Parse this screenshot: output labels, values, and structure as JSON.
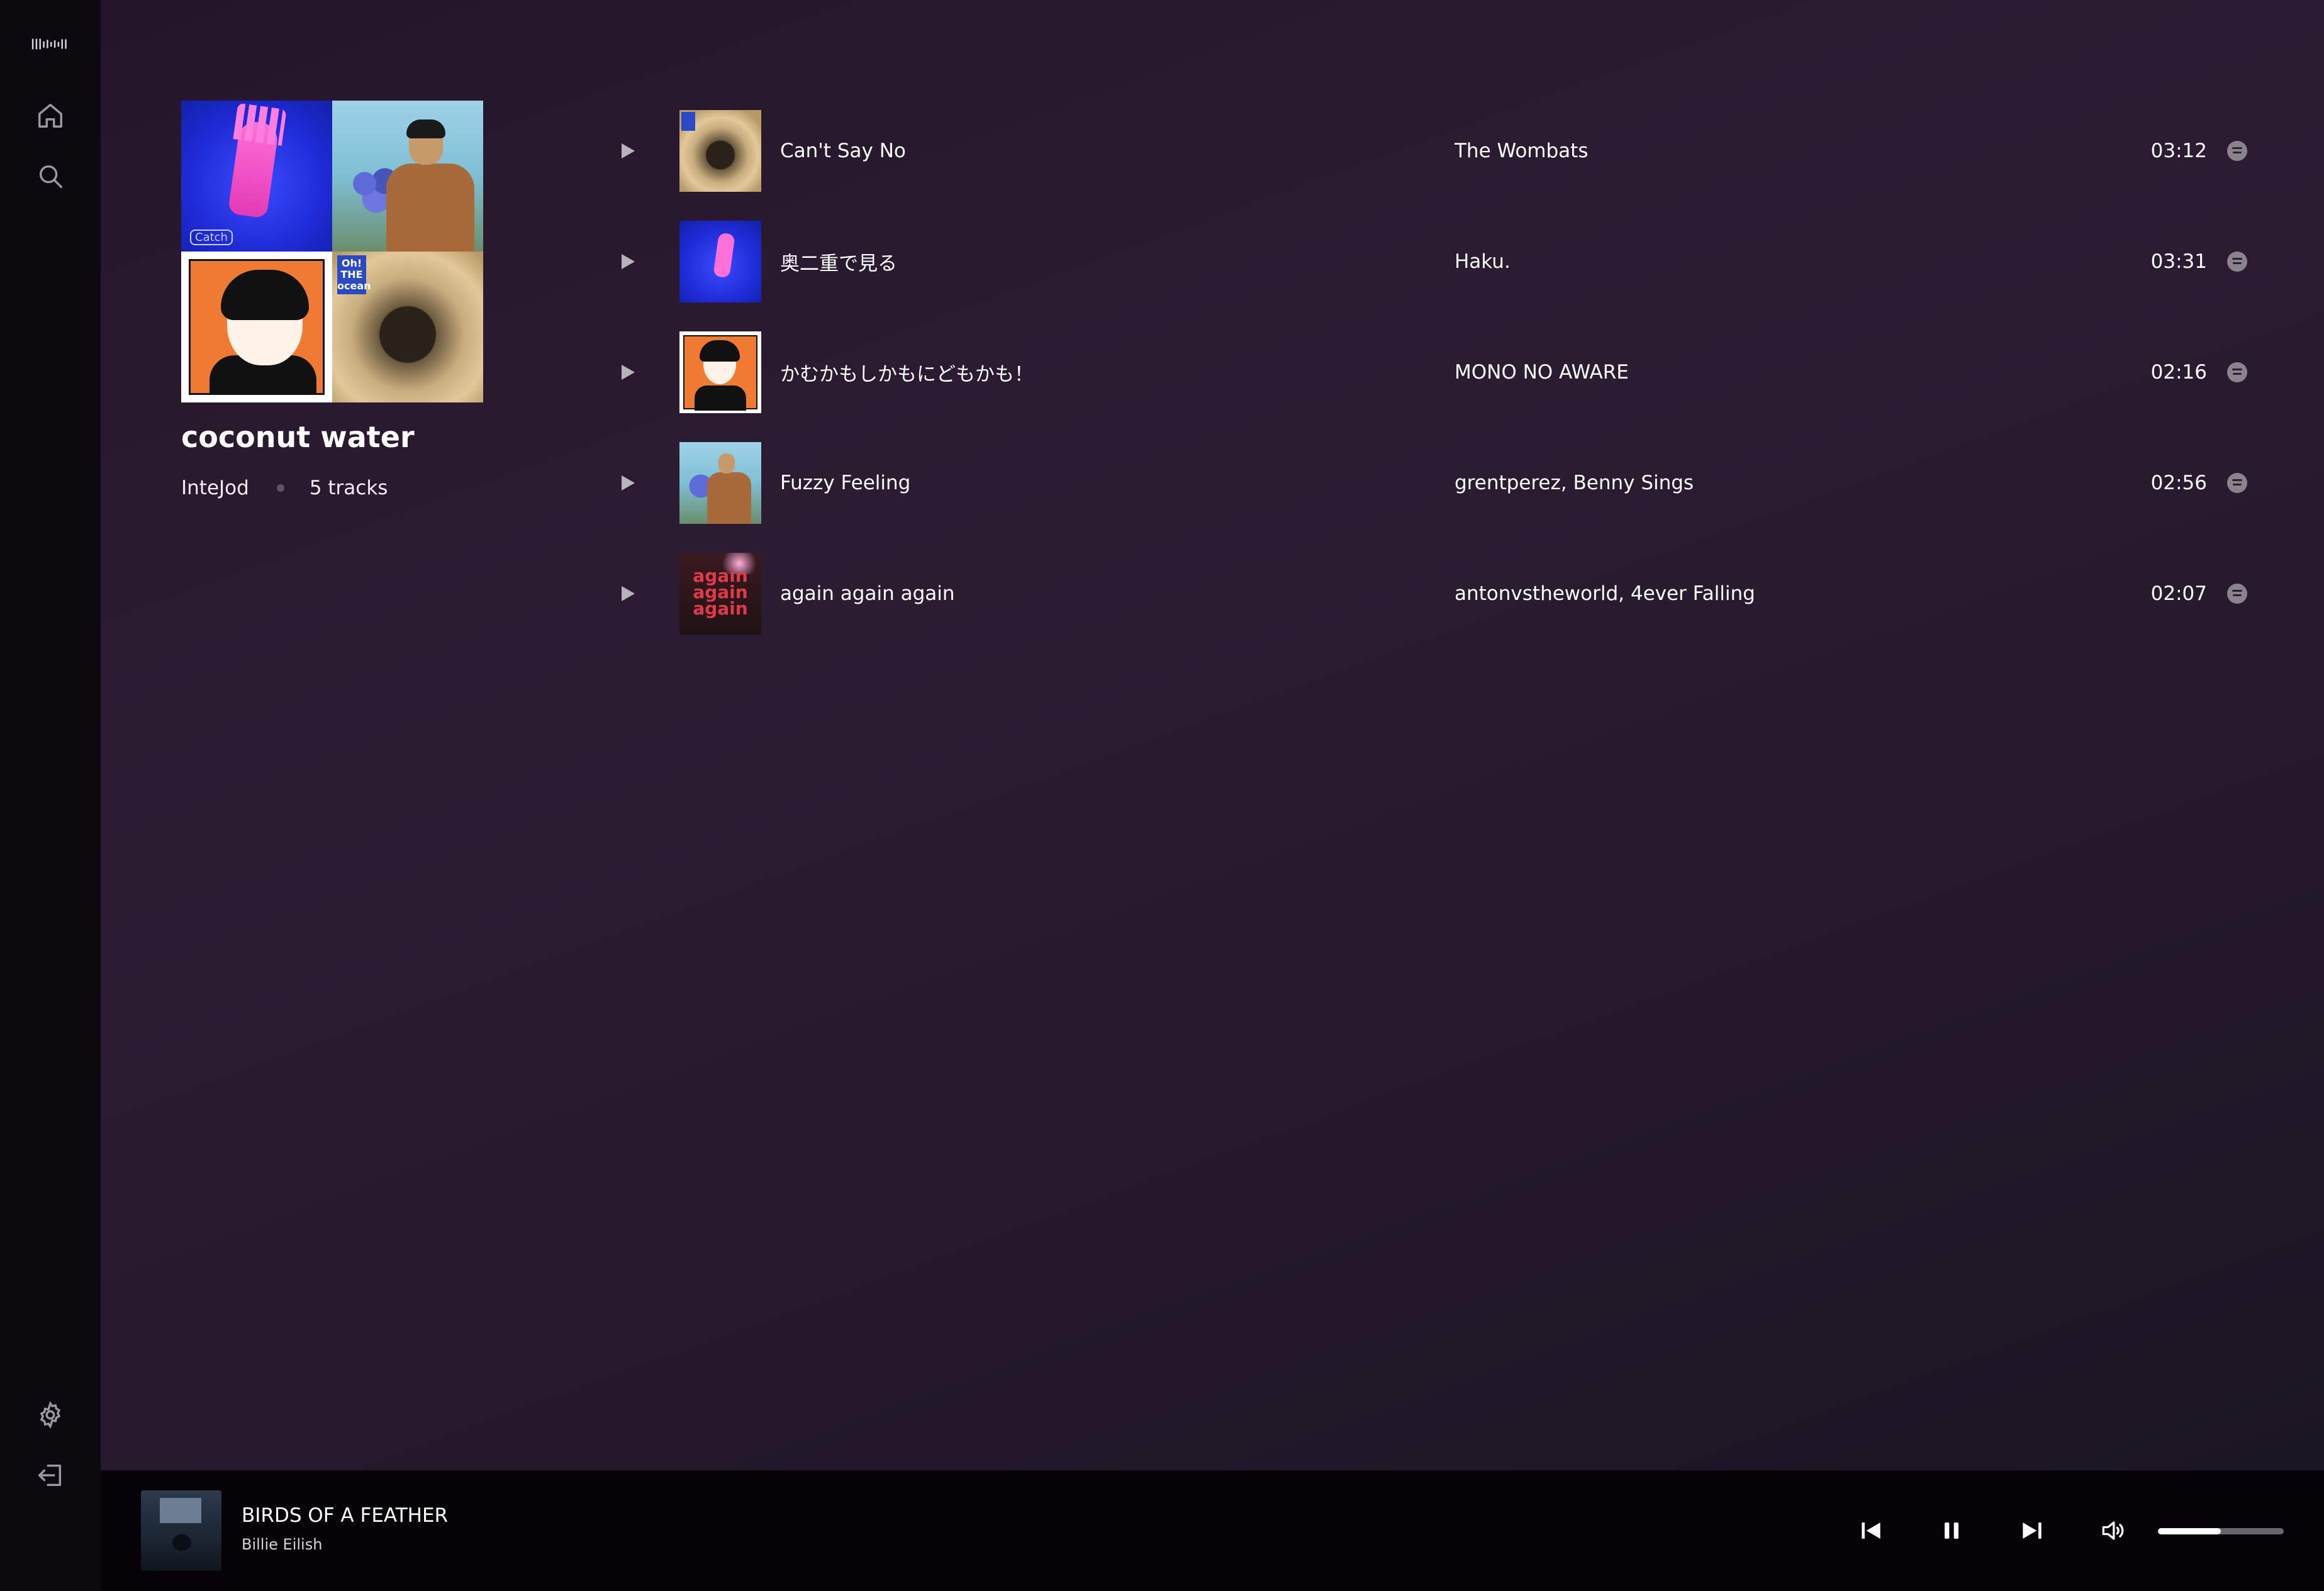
{
  "sidebar": {
    "icons": [
      "logo-bars-icon",
      "home-icon",
      "search-icon",
      "settings-icon",
      "logout-icon"
    ]
  },
  "playlist": {
    "title": "coconut water",
    "owner": "InteJod",
    "track_count": "5 tracks"
  },
  "tracks": [
    {
      "title": "Can't Say No",
      "artist": "The Wombats",
      "duration": "03:12"
    },
    {
      "title": "奥二重で見る",
      "artist": "Haku.",
      "duration": "03:31"
    },
    {
      "title": "かむかもしかもにどもかも！",
      "artist": "MONO NO AWARE",
      "duration": "02:16"
    },
    {
      "title": "Fuzzy Feeling",
      "artist": "grentperez, Benny Sings",
      "duration": "02:56"
    },
    {
      "title": "again again again",
      "artist": "antonvstheworld, 4ever Falling",
      "duration": "02:07"
    }
  ],
  "cover_art_text": {
    "glove_tag": "Catch",
    "ocean_logo": "Oh! THE ocean",
    "again_word": "again"
  },
  "now_playing": {
    "title": "BIRDS OF A FEATHER",
    "artist": "Billie Eilish",
    "volume_fraction": 0.5
  },
  "colors": {
    "sidebar_bg": "#0d090f",
    "main_bg": "#2a1c31",
    "player_bg": "#050306",
    "muted_icon": "#8a838c"
  }
}
